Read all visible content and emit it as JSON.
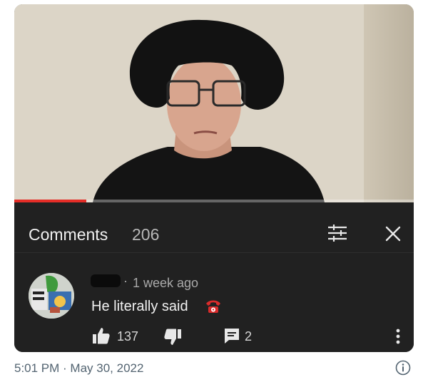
{
  "video": {
    "progress_fraction": 0.18
  },
  "comments_panel": {
    "title": "Comments",
    "count": "206",
    "filter_icon": "tune-icon",
    "close_icon": "close-icon"
  },
  "comment": {
    "meta_separator": "·",
    "time_ago": "1 week ago",
    "text": "He literally said",
    "emoji": "telephone-icon",
    "like_count": "137",
    "reply_count": "2"
  },
  "footer": {
    "timestamp": "5:01 PM · May 30, 2022",
    "info_icon": "info-icon"
  },
  "colors": {
    "panel_bg": "#212121",
    "progress": "#e52d27",
    "text_primary": "#f1f1f1",
    "text_secondary": "#aaaaaa",
    "footer_text": "#536471"
  }
}
